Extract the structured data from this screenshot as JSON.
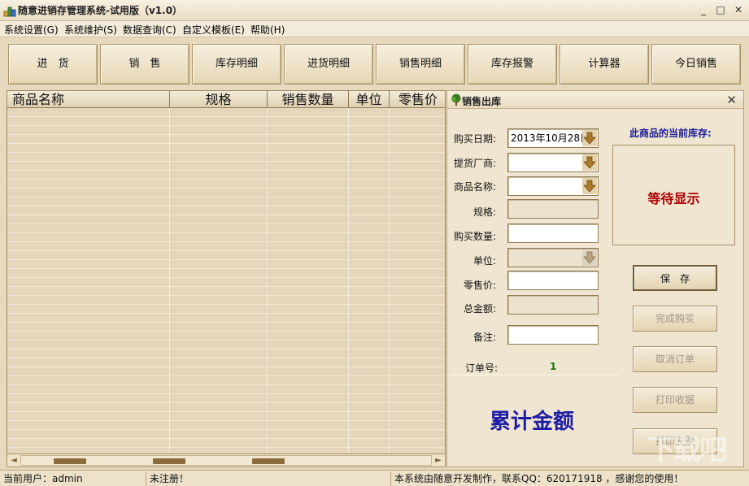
{
  "window": {
    "title": "随意进销存管理系统-试用版（v1.0）",
    "minimize": "_",
    "maximize": "□",
    "close": "✕"
  },
  "menu": [
    "系统设置(G)",
    "系统维护(S)",
    "数据查询(C)",
    "自定义模板(E)",
    "帮助(H)"
  ],
  "toolbar": [
    "进　货",
    "销　售",
    "库存明细",
    "进货明细",
    "销售明细",
    "库存报警",
    "计算器",
    "今日销售"
  ],
  "grid": {
    "columns": [
      "商品名称",
      "规格",
      "销售数量",
      "单位",
      "零售价"
    ]
  },
  "scrollbar": {
    "left_arrow": "◄",
    "right_arrow": "►"
  },
  "panel": {
    "title": "销售出库",
    "close": "✕",
    "fields": {
      "date_label": "购买日期:",
      "date_value": "2013年10月28日",
      "vendor_label": "提货厂商:",
      "product_label": "商品名称:",
      "spec_label": "规格:",
      "qty_label": "购买数量:",
      "unit_label": "单位:",
      "price_label": "零售价:",
      "total_label": "总金额:",
      "note_label": "备注:"
    },
    "stock_label": "此商品的当前库存:",
    "stock_value": "等待显示",
    "buttons": {
      "save": "保　存",
      "complete": "完成购买",
      "cancel_order": "取消订单",
      "print_receipt": "打印收据",
      "print_invoice": "打印发票"
    },
    "order_label": "订单号:",
    "order_value": "1",
    "total_title": "累计金额"
  },
  "status": {
    "user": "当前用户：admin",
    "registration": "未注册！",
    "info": "本系统由随意开发制作，联系QQ：620171918 ，感谢您的使用！"
  },
  "watermark": "下载吧"
}
